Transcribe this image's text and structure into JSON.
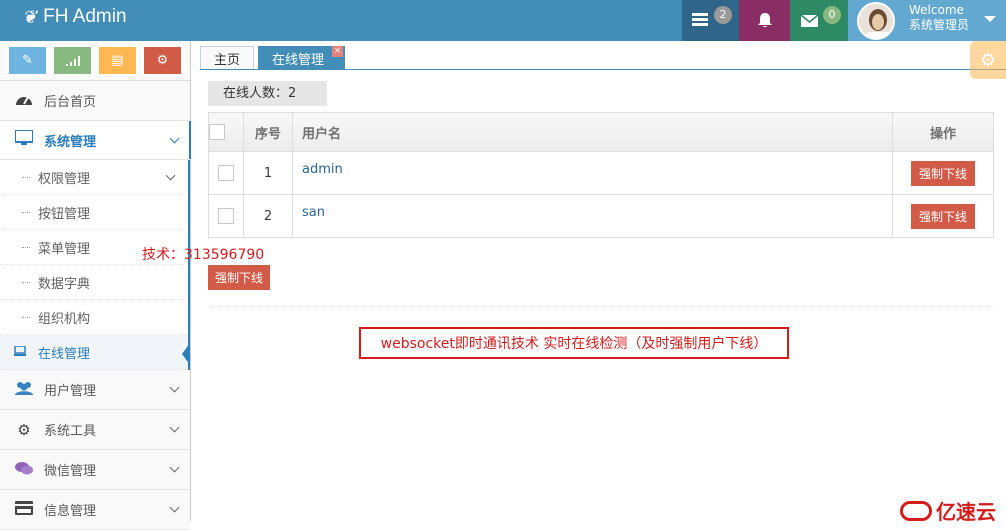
{
  "brand": {
    "title": "FH Admin",
    "icon": "leaf-icon"
  },
  "navbar": {
    "tasks_count": "2",
    "messages_count": "0",
    "welcome": "Welcome",
    "user_role": "系统管理员",
    "colors": {
      "bar": "#438eb9",
      "tasks": "#2e6589",
      "notifications": "#892e65",
      "messages": "#2e8965",
      "user": "#62a8d1"
    }
  },
  "shortcuts": [
    {
      "icon": "pencil-icon",
      "color": "#6fb3e0"
    },
    {
      "icon": "signal-icon",
      "color": "#87b87f"
    },
    {
      "icon": "book-icon",
      "color": "#ffb752"
    },
    {
      "icon": "cogs-icon",
      "color": "#d15b47"
    }
  ],
  "sidebar": {
    "dashboard": "后台首页",
    "system": "系统管理",
    "system_children": [
      "权限管理",
      "按钮管理",
      "菜单管理",
      "数据字典",
      "组织机构",
      "在线管理"
    ],
    "users": "用户管理",
    "tools": "系统工具",
    "wechat": "微信管理",
    "info": "信息管理"
  },
  "tabs": {
    "home": "主页",
    "current": "在线管理",
    "close": "×"
  },
  "main": {
    "online_count": "在线人数：2",
    "table": {
      "headers": {
        "num": "序号",
        "username": "用户名",
        "op": "操作"
      },
      "rows": [
        {
          "num": "1",
          "username": "admin",
          "action": "强制下线"
        },
        {
          "num": "2",
          "username": "san",
          "action": "强制下线"
        }
      ]
    },
    "bulk_action": "强制下线"
  },
  "annotations": {
    "tech_contact": "技术：313596790",
    "feature_note": "websocket即时通讯技术    实时在线检测（及时强制用户下线）",
    "watermark": "亿速云"
  }
}
